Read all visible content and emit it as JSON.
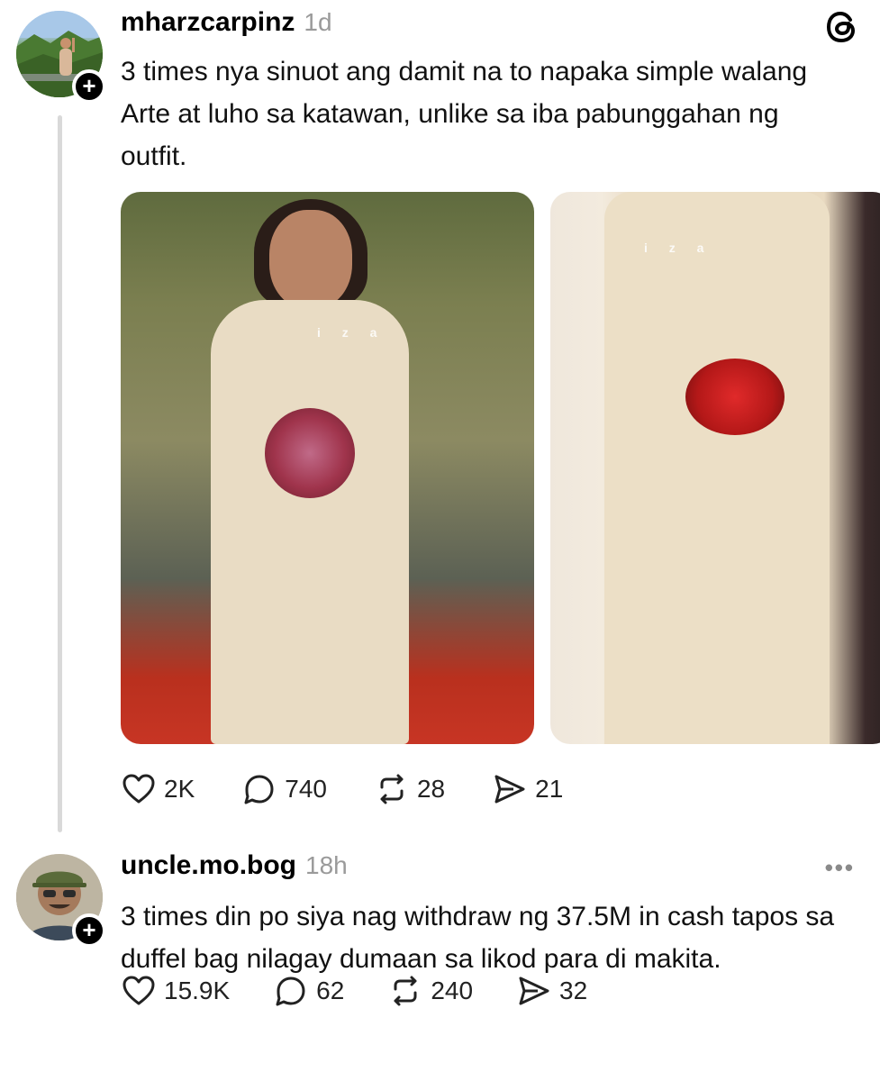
{
  "posts": [
    {
      "username": "mharzcarpinz",
      "timestamp": "1d",
      "text": "3 times nya sinuot ang damit na to napaka simple walang Arte at luho sa katawan, unlike sa iba pabunggahan ng outfit.",
      "images": [
        {
          "icon": "photo",
          "watermark": "i z a"
        },
        {
          "icon": "photo",
          "watermark": "i z a"
        }
      ],
      "actions": {
        "likes": "2K",
        "replies": "740",
        "reposts": "28",
        "shares": "21"
      }
    },
    {
      "username": "uncle.mo.bog",
      "timestamp": "18h",
      "text": "3 times din po siya nag withdraw ng 37.5M in cash tapos sa duffel bag nilagay dumaan sa likod para di makita.",
      "actions": {
        "likes": "15.9K",
        "replies": "62",
        "reposts": "240",
        "shares": "32"
      }
    }
  ],
  "icons": {
    "app_logo": "threads-logo-icon",
    "more": "more-options-icon",
    "follow": "plus-icon",
    "like": "heart-icon",
    "reply": "comment-bubble-icon",
    "repost": "repost-arrows-icon",
    "share": "send-icon"
  }
}
